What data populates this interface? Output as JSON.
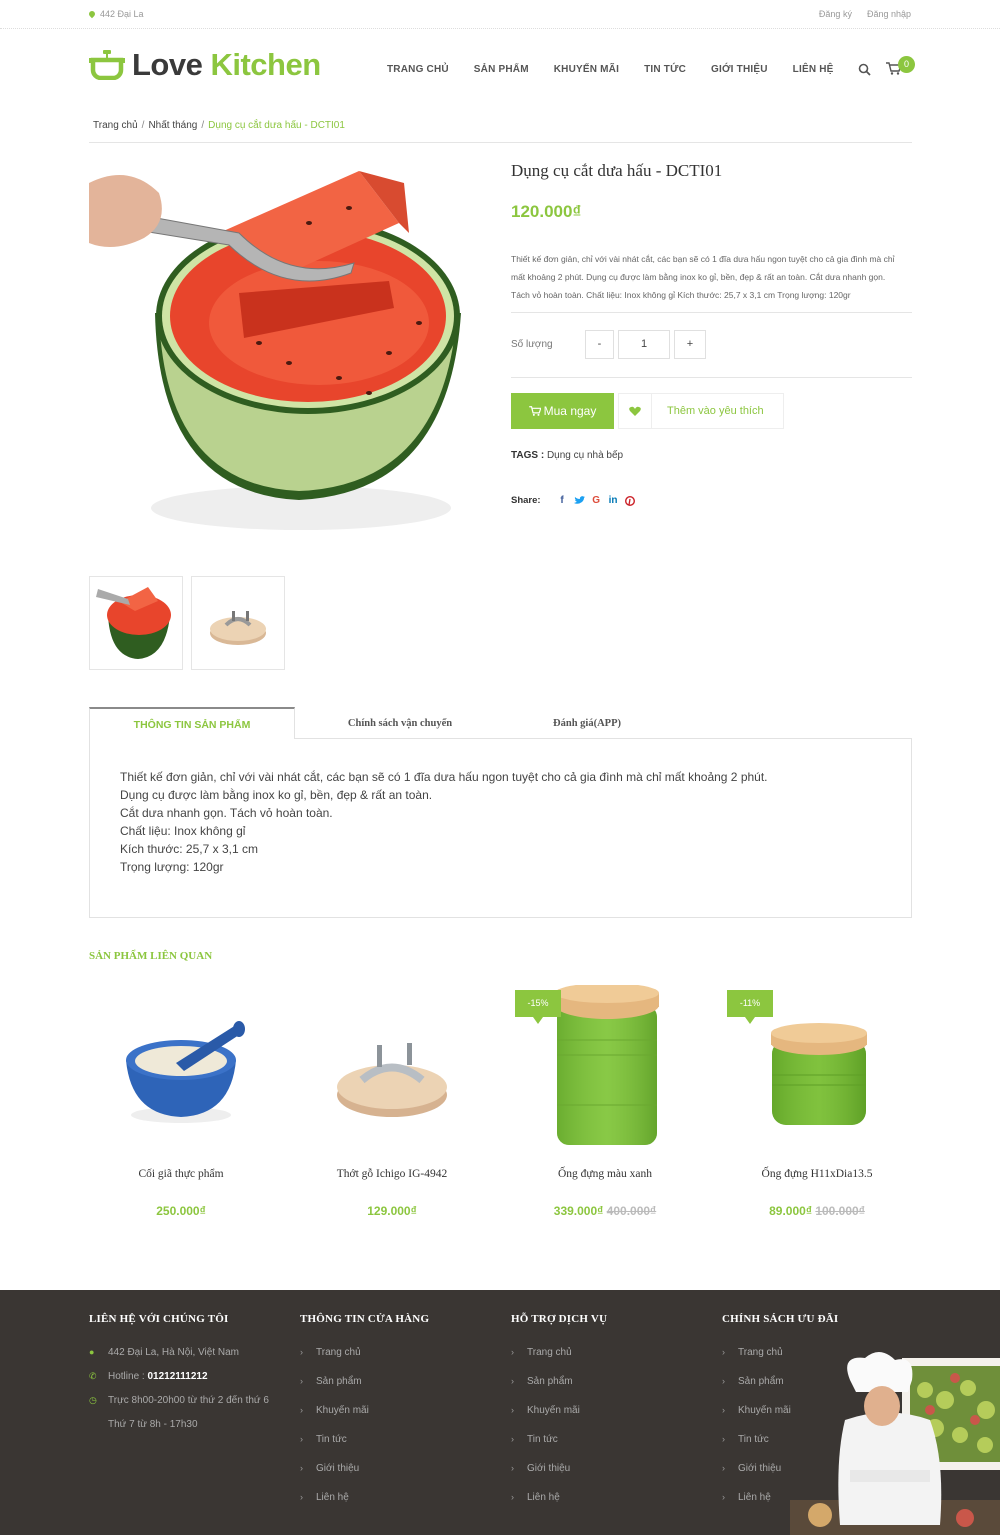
{
  "topbar": {
    "address": "442 Đại La",
    "register": "Đăng ký",
    "login": "Đăng nhập"
  },
  "brand": {
    "love": "Love",
    "kitchen": "Kitchen"
  },
  "nav": [
    {
      "label": "TRANG CHỦ"
    },
    {
      "label": "SẢN PHẨM"
    },
    {
      "label": "KHUYẾN MÃI"
    },
    {
      "label": "TIN TỨC"
    },
    {
      "label": "GIỚI THIỆU"
    },
    {
      "label": "LIÊN HỆ"
    }
  ],
  "cart_count": "0",
  "breadcrumb": {
    "home": "Trang chủ",
    "category": "Nhất tháng",
    "current": "Dụng cụ cắt dưa hấu - DCTI01"
  },
  "product": {
    "title": "Dụng cụ cắt dưa hấu - DCTI01",
    "price": "120.000₫",
    "description": "Thiết kế đơn giản, chỉ với vài nhát cắt, các bạn sẽ có 1 đĩa dưa hấu ngon tuyệt cho cả gia đình mà chỉ mất khoảng 2 phút. Dụng cụ được làm bằng inox ko gỉ, bền, đẹp & rất an toàn. Cắt dưa nhanh gọn. Tách vỏ hoàn toàn. Chất liệu: Inox không gỉ Kích thước: 25,7 x 3,1 cm Trọng lượng: 120gr",
    "quantity_label": "Số lượng",
    "minus": "-",
    "quantity": "1",
    "plus": "+",
    "buy_label": "Mua ngay",
    "wishlist_label": "Thêm vào yêu thích",
    "tags_label": "TAGS :",
    "tags_value": "Dụng cụ nhà bếp",
    "share_label": "Share:"
  },
  "tabs": [
    {
      "label": "THÔNG TIN SẢN PHẨM"
    },
    {
      "label": "Chính sách vận chuyển"
    },
    {
      "label": "Đánh giá(APP)"
    }
  ],
  "tab_content": [
    " Thiết kế đơn giản, chỉ với vài nhát cắt, các bạn sẽ có 1 đĩa dưa hấu ngon tuyệt cho cả gia đình mà chỉ mất khoảng 2 phút.",
    "Dụng cụ được làm bằng inox ko gỉ, bền, đẹp & rất an toàn.",
    "Cắt dưa nhanh gọn. Tách vỏ hoàn toàn.",
    "Chất liệu: Inox không gỉ",
    "Kích thước: 25,7 x 3,1 cm",
    "Trọng lượng: 120gr"
  ],
  "related": {
    "title": "SẢN PHẨM LIÊN QUAN",
    "items": [
      {
        "name": "Cối giã thực phẩm",
        "price": "250.000₫",
        "old_price": "",
        "badge": ""
      },
      {
        "name": "Thớt gỗ Ichigo IG-4942",
        "price": "129.000₫",
        "old_price": "",
        "badge": ""
      },
      {
        "name": "Ống đựng màu xanh",
        "price": "339.000₫",
        "old_price": "400.000₫",
        "badge": "-15%"
      },
      {
        "name": "Ống đựng H11xDia13.5",
        "price": "89.000₫",
        "old_price": "100.000₫",
        "badge": "-11%"
      }
    ]
  },
  "footer": {
    "contact": {
      "title": "LIÊN HỆ VỚI CHÚNG TÔI",
      "address": "442 Đại La, Hà Nội, Việt Nam",
      "hotline_label": "Hotline :",
      "hotline": "01212111212",
      "hours1": "Trực 8h00-20h00 từ thứ 2 đến thứ 6",
      "hours2": "Thứ 7 từ 8h - 17h30"
    },
    "columns": [
      {
        "title": "THÔNG TIN CỬA HÀNG",
        "links": [
          "Trang chủ",
          "Sản phẩm",
          "Khuyến mãi",
          "Tin tức",
          "Giới thiệu",
          "Liên hệ"
        ]
      },
      {
        "title": "HỖ TRỢ DỊCH VỤ",
        "links": [
          "Trang chủ",
          "Sản phẩm",
          "Khuyến mãi",
          "Tin tức",
          "Giới thiệu",
          "Liên hệ"
        ]
      },
      {
        "title": "CHÍNH SÁCH ƯU ĐÃI",
        "links": [
          "Trang chủ",
          "Sản phẩm",
          "Khuyến mãi",
          "Tin tức",
          "Giới thiệu",
          "Liên hệ"
        ]
      }
    ]
  },
  "colors": {
    "accent": "#8cc63f",
    "footer_bg": "#3a3633",
    "text": "#333333"
  }
}
